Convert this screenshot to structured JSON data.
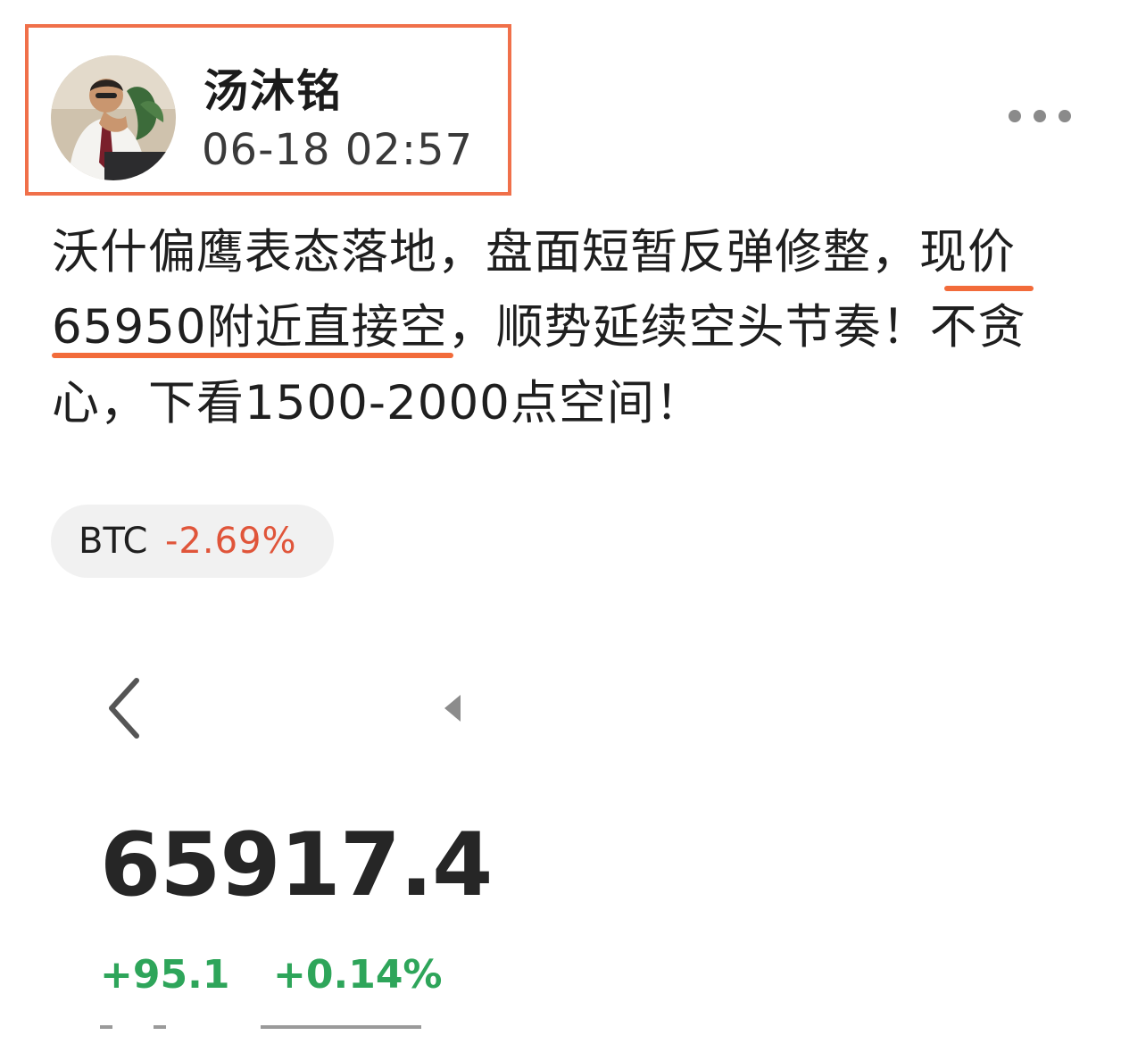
{
  "author": {
    "name": "汤沐铭",
    "time": "06-18 02:57"
  },
  "post": {
    "lines": [
      "沃什偏鹰表态落地，盘面短暂反弹修整，现价",
      "65950附近直接空，顺势延续空头节奏！不贪",
      "心，下看1500-2000点空间！"
    ]
  },
  "ticker": {
    "symbol": "BTC",
    "change": "-2.69%",
    "change_color": "#e0553a"
  },
  "quote": {
    "price": "65917.4",
    "change_abs": "+95.1",
    "change_pct": "+0.14%",
    "up_color": "#2ea55a"
  },
  "icons": {
    "more": "more-horizontal-icon",
    "back": "chevron-left-icon",
    "arrow": "triangle-left-icon"
  },
  "accent": "#f0704a"
}
